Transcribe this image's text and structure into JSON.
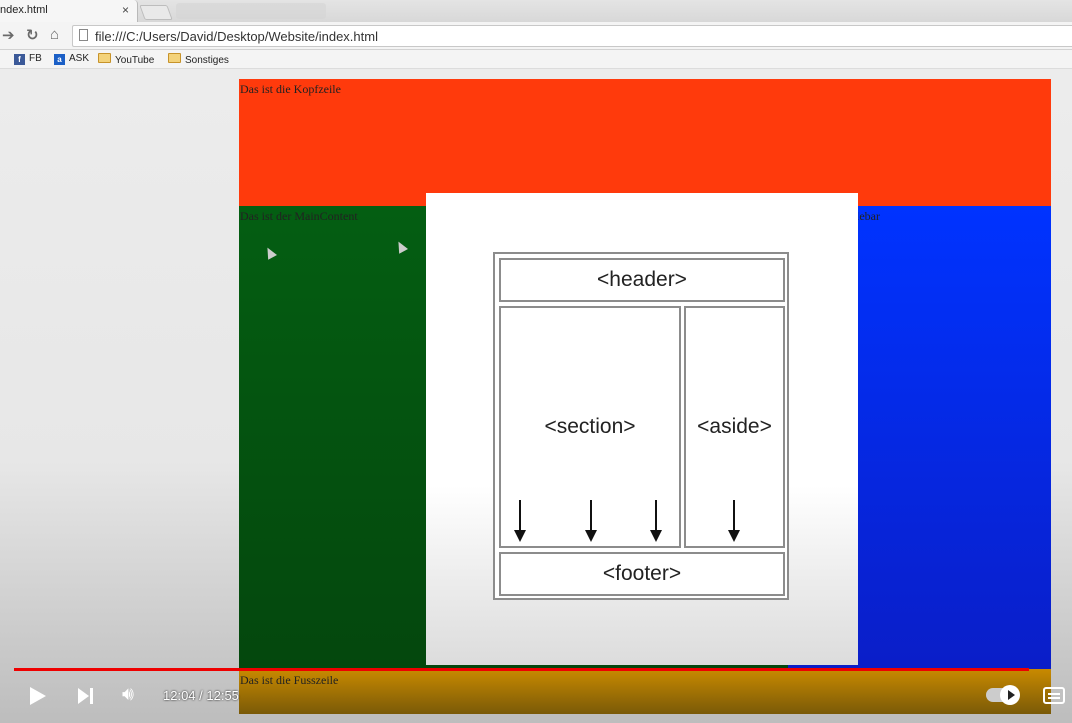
{
  "browser": {
    "tab_title": "ndex.html",
    "tab_close": "×",
    "url": "file:///C:/Users/David/Desktop/Website/index.html",
    "bookmarks": [
      {
        "label": "FB",
        "icon": "facebook-icon",
        "color": "#3b5998"
      },
      {
        "label": "ASK",
        "icon": "ask-icon",
        "color": "#1b5fc6"
      },
      {
        "label": "YouTube",
        "icon": "folder-icon"
      },
      {
        "label": "Sonstiges",
        "icon": "folder-icon"
      }
    ]
  },
  "page": {
    "header_text": "Das ist die Kopfzeile",
    "main_text": "Das ist der MainContent",
    "sidebar_text": "lebar",
    "footer_text": "Das ist die Fusszeile",
    "colors": {
      "header": "#ff3a0c",
      "main": "#045e12",
      "sidebar": "#0033ff",
      "footer": "#c98a00"
    }
  },
  "diagram": {
    "header": "<header>",
    "section": "<section>",
    "aside": "<aside>",
    "footer": "<footer>"
  },
  "player": {
    "time": "12:04 / 12:55",
    "progress": 0.959,
    "autoplay": true
  }
}
